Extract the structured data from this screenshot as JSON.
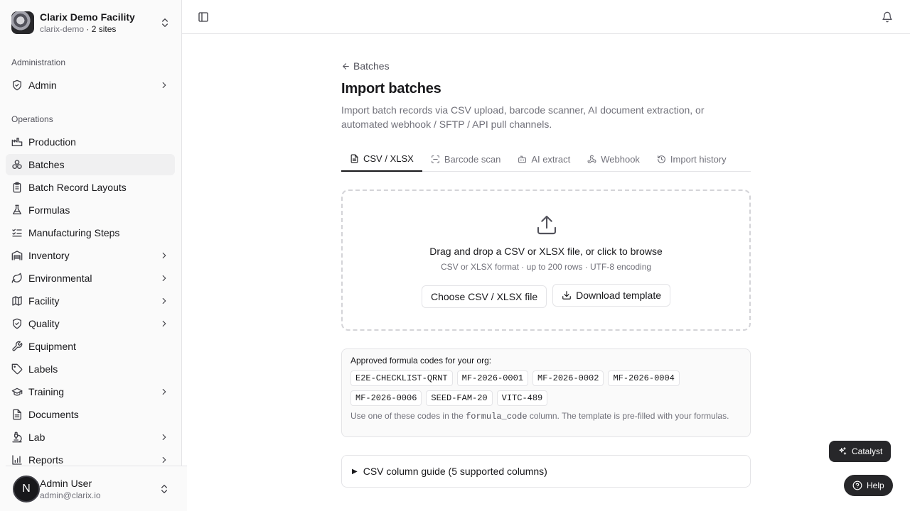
{
  "org": {
    "name": "Clarix Demo Facility",
    "slug": "clarix-demo",
    "sites": "2 sites",
    "separator": " · "
  },
  "groups": {
    "administration": "Administration",
    "operations": "Operations"
  },
  "nav": {
    "admin": "Admin",
    "items": [
      {
        "label": "Production"
      },
      {
        "label": "Batches"
      },
      {
        "label": "Batch Record Layouts"
      },
      {
        "label": "Formulas"
      },
      {
        "label": "Manufacturing Steps"
      },
      {
        "label": "Inventory"
      },
      {
        "label": "Environmental"
      },
      {
        "label": "Facility"
      },
      {
        "label": "Quality"
      },
      {
        "label": "Equipment"
      },
      {
        "label": "Labels"
      },
      {
        "label": "Training"
      },
      {
        "label": "Documents"
      },
      {
        "label": "Lab"
      },
      {
        "label": "Reports"
      }
    ]
  },
  "user": {
    "initial": "N",
    "name": "Admin User",
    "email": "admin@clarix.io"
  },
  "page": {
    "back": "Batches",
    "title": "Import batches",
    "description": "Import batch records via CSV upload, barcode scanner, AI document extraction, or automated webhook / SFTP / API pull channels."
  },
  "tabs": [
    "CSV / XLSX",
    "Barcode scan",
    "AI extract",
    "Webhook",
    "Import history"
  ],
  "dropzone": {
    "title": "Drag and drop a CSV or XLSX file, or click to browse",
    "subtitle": "CSV or XLSX format · up to 200 rows · UTF-8 encoding",
    "choose_label": "Choose CSV / XLSX file",
    "template_label": "Download template"
  },
  "codes": {
    "title": "Approved formula codes for your org:",
    "items": [
      "E2E-CHECKLIST-QRNT",
      "MF-2026-0001",
      "MF-2026-0002",
      "MF-2026-0004",
      "MF-2026-0006",
      "SEED-FAM-20",
      "VITC-489"
    ],
    "note_prefix": "Use one of these codes in the ",
    "note_code": "formula_code",
    "note_suffix": " column. The template is pre-filled with your formulas."
  },
  "guide": {
    "label": "CSV column guide (5 supported columns)"
  },
  "fabs": {
    "catalyst": "Catalyst",
    "help": "Help"
  }
}
